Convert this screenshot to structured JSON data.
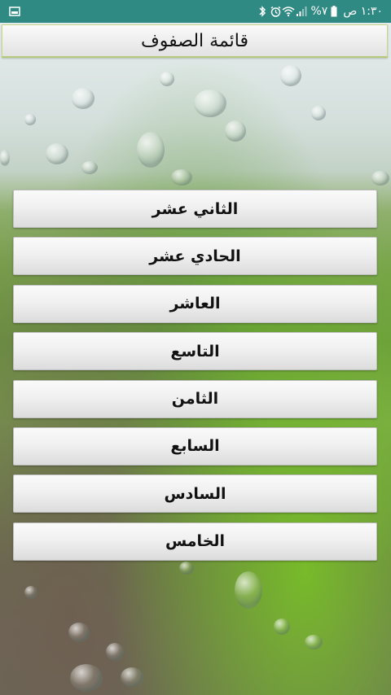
{
  "status_bar": {
    "time": "١:٣٠ ص",
    "battery": "%٧",
    "icons": [
      "battery-icon",
      "signal-icon",
      "wifi-icon",
      "alarm-icon",
      "bluetooth-icon",
      "gallery-notification-icon"
    ],
    "color": "#2e8a83"
  },
  "header": {
    "title": "قائمة الصفوف"
  },
  "grades": [
    {
      "label": "الثاني عشر"
    },
    {
      "label": "الحادي عشر"
    },
    {
      "label": "العاشر"
    },
    {
      "label": "التاسع"
    },
    {
      "label": "الثامن"
    },
    {
      "label": "السابع"
    },
    {
      "label": "السادس"
    },
    {
      "label": "الخامس"
    }
  ]
}
